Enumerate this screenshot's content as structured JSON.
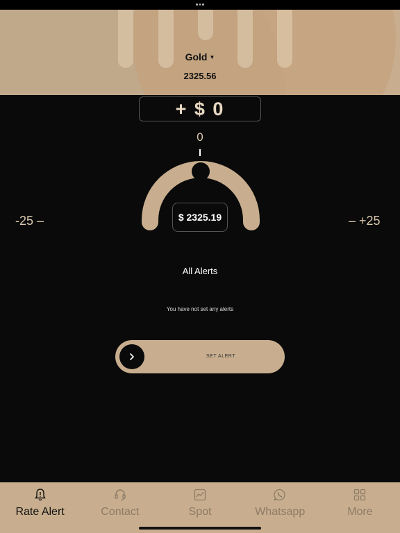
{
  "header": {
    "metal_selector": "Gold",
    "price": "2325.56"
  },
  "alert_setter": {
    "offset_display": "+ $ 0",
    "gauge_value": "0",
    "current_price": "$ 2325.19",
    "min_label": "-25 –",
    "max_label": "– +25"
  },
  "alerts": {
    "title": "All Alerts",
    "empty_message": "You have not set any alerts"
  },
  "slider": {
    "label": "SET ALERT"
  },
  "nav": {
    "items": [
      {
        "label": "Rate Alert",
        "icon": "bell-alert-icon",
        "active": true
      },
      {
        "label": "Contact",
        "icon": "headset-icon",
        "active": false
      },
      {
        "label": "Spot",
        "icon": "chart-icon",
        "active": false
      },
      {
        "label": "Whatsapp",
        "icon": "whatsapp-icon",
        "active": false
      },
      {
        "label": "More",
        "icon": "grid-icon",
        "active": false
      }
    ]
  },
  "colors": {
    "accent": "#c8ae8e",
    "background": "#0a0a0a",
    "nav_inactive": "#8c7b66"
  }
}
